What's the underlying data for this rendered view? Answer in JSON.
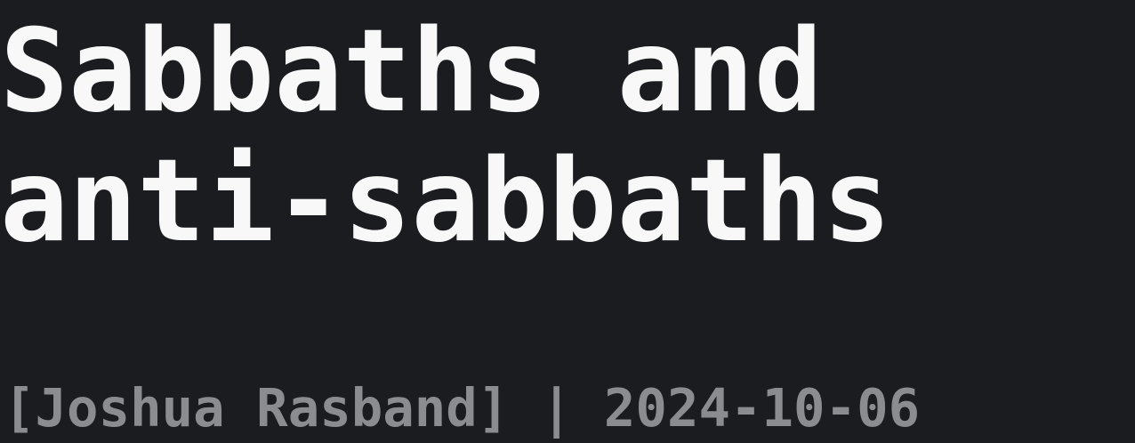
{
  "post": {
    "title_line_1": "Sabbaths and",
    "title_line_2": "anti-sabbaths",
    "byline": "[Joshua Rasband] | 2024-10-06"
  }
}
